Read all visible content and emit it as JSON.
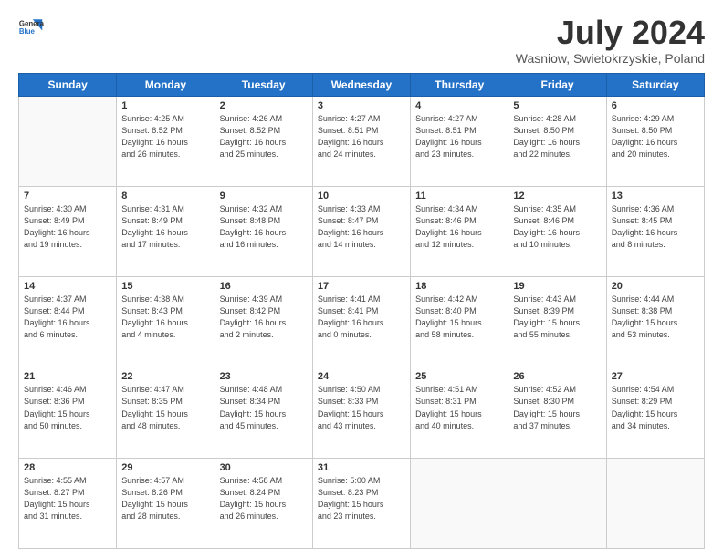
{
  "logo": {
    "line1": "General",
    "line2": "Blue"
  },
  "title": "July 2024",
  "location": "Wasniow, Swietokrzyskie, Poland",
  "days_of_week": [
    "Sunday",
    "Monday",
    "Tuesday",
    "Wednesday",
    "Thursday",
    "Friday",
    "Saturday"
  ],
  "weeks": [
    [
      {
        "day": "",
        "info": ""
      },
      {
        "day": "1",
        "info": "Sunrise: 4:25 AM\nSunset: 8:52 PM\nDaylight: 16 hours\nand 26 minutes."
      },
      {
        "day": "2",
        "info": "Sunrise: 4:26 AM\nSunset: 8:52 PM\nDaylight: 16 hours\nand 25 minutes."
      },
      {
        "day": "3",
        "info": "Sunrise: 4:27 AM\nSunset: 8:51 PM\nDaylight: 16 hours\nand 24 minutes."
      },
      {
        "day": "4",
        "info": "Sunrise: 4:27 AM\nSunset: 8:51 PM\nDaylight: 16 hours\nand 23 minutes."
      },
      {
        "day": "5",
        "info": "Sunrise: 4:28 AM\nSunset: 8:50 PM\nDaylight: 16 hours\nand 22 minutes."
      },
      {
        "day": "6",
        "info": "Sunrise: 4:29 AM\nSunset: 8:50 PM\nDaylight: 16 hours\nand 20 minutes."
      }
    ],
    [
      {
        "day": "7",
        "info": "Sunrise: 4:30 AM\nSunset: 8:49 PM\nDaylight: 16 hours\nand 19 minutes."
      },
      {
        "day": "8",
        "info": "Sunrise: 4:31 AM\nSunset: 8:49 PM\nDaylight: 16 hours\nand 17 minutes."
      },
      {
        "day": "9",
        "info": "Sunrise: 4:32 AM\nSunset: 8:48 PM\nDaylight: 16 hours\nand 16 minutes."
      },
      {
        "day": "10",
        "info": "Sunrise: 4:33 AM\nSunset: 8:47 PM\nDaylight: 16 hours\nand 14 minutes."
      },
      {
        "day": "11",
        "info": "Sunrise: 4:34 AM\nSunset: 8:46 PM\nDaylight: 16 hours\nand 12 minutes."
      },
      {
        "day": "12",
        "info": "Sunrise: 4:35 AM\nSunset: 8:46 PM\nDaylight: 16 hours\nand 10 minutes."
      },
      {
        "day": "13",
        "info": "Sunrise: 4:36 AM\nSunset: 8:45 PM\nDaylight: 16 hours\nand 8 minutes."
      }
    ],
    [
      {
        "day": "14",
        "info": "Sunrise: 4:37 AM\nSunset: 8:44 PM\nDaylight: 16 hours\nand 6 minutes."
      },
      {
        "day": "15",
        "info": "Sunrise: 4:38 AM\nSunset: 8:43 PM\nDaylight: 16 hours\nand 4 minutes."
      },
      {
        "day": "16",
        "info": "Sunrise: 4:39 AM\nSunset: 8:42 PM\nDaylight: 16 hours\nand 2 minutes."
      },
      {
        "day": "17",
        "info": "Sunrise: 4:41 AM\nSunset: 8:41 PM\nDaylight: 16 hours\nand 0 minutes."
      },
      {
        "day": "18",
        "info": "Sunrise: 4:42 AM\nSunset: 8:40 PM\nDaylight: 15 hours\nand 58 minutes."
      },
      {
        "day": "19",
        "info": "Sunrise: 4:43 AM\nSunset: 8:39 PM\nDaylight: 15 hours\nand 55 minutes."
      },
      {
        "day": "20",
        "info": "Sunrise: 4:44 AM\nSunset: 8:38 PM\nDaylight: 15 hours\nand 53 minutes."
      }
    ],
    [
      {
        "day": "21",
        "info": "Sunrise: 4:46 AM\nSunset: 8:36 PM\nDaylight: 15 hours\nand 50 minutes."
      },
      {
        "day": "22",
        "info": "Sunrise: 4:47 AM\nSunset: 8:35 PM\nDaylight: 15 hours\nand 48 minutes."
      },
      {
        "day": "23",
        "info": "Sunrise: 4:48 AM\nSunset: 8:34 PM\nDaylight: 15 hours\nand 45 minutes."
      },
      {
        "day": "24",
        "info": "Sunrise: 4:50 AM\nSunset: 8:33 PM\nDaylight: 15 hours\nand 43 minutes."
      },
      {
        "day": "25",
        "info": "Sunrise: 4:51 AM\nSunset: 8:31 PM\nDaylight: 15 hours\nand 40 minutes."
      },
      {
        "day": "26",
        "info": "Sunrise: 4:52 AM\nSunset: 8:30 PM\nDaylight: 15 hours\nand 37 minutes."
      },
      {
        "day": "27",
        "info": "Sunrise: 4:54 AM\nSunset: 8:29 PM\nDaylight: 15 hours\nand 34 minutes."
      }
    ],
    [
      {
        "day": "28",
        "info": "Sunrise: 4:55 AM\nSunset: 8:27 PM\nDaylight: 15 hours\nand 31 minutes."
      },
      {
        "day": "29",
        "info": "Sunrise: 4:57 AM\nSunset: 8:26 PM\nDaylight: 15 hours\nand 28 minutes."
      },
      {
        "day": "30",
        "info": "Sunrise: 4:58 AM\nSunset: 8:24 PM\nDaylight: 15 hours\nand 26 minutes."
      },
      {
        "day": "31",
        "info": "Sunrise: 5:00 AM\nSunset: 8:23 PM\nDaylight: 15 hours\nand 23 minutes."
      },
      {
        "day": "",
        "info": ""
      },
      {
        "day": "",
        "info": ""
      },
      {
        "day": "",
        "info": ""
      }
    ]
  ]
}
